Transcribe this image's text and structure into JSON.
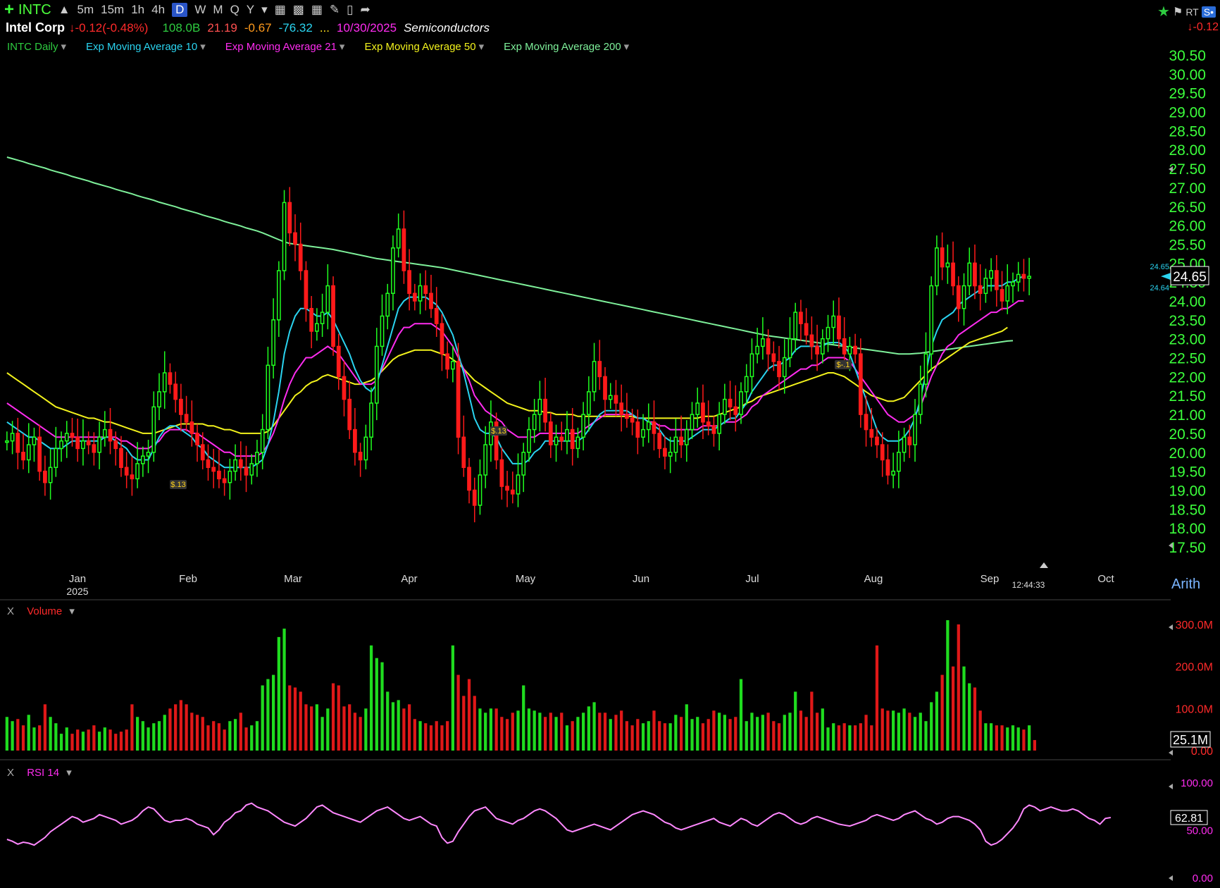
{
  "toolbar": {
    "ticker": "INTC",
    "timeframes": [
      "5m",
      "15m",
      "1h",
      "4h",
      "D",
      "W",
      "M",
      "Q",
      "Y"
    ],
    "active_timeframe": "D",
    "right_badge_rt": "RT",
    "right_badge_s": "S•",
    "right_change": "-0.12"
  },
  "info": {
    "name": "Intel Corp",
    "change": "-0.12(-0.48%)",
    "market_cap": "108.0B",
    "pe": "21.19",
    "v1": "-0.67",
    "v2": "-76.32",
    "dots": "...",
    "date": "10/30/2025",
    "sector": "Semiconductors"
  },
  "studies": [
    {
      "label": "INTC Daily",
      "color": "#2ecc40"
    },
    {
      "label": "Exp Moving Average 10",
      "color": "#2ad4f0"
    },
    {
      "label": "Exp Moving Average 21",
      "color": "#ff2cf0"
    },
    {
      "label": "Exp Moving Average 50",
      "color": "#f2f21c"
    },
    {
      "label": "Exp Moving Average 200",
      "color": "#7ef09a"
    }
  ],
  "chart_data": {
    "type": "candlestick",
    "price_axis": {
      "ticks": [
        "30.50",
        "30.00",
        "29.50",
        "29.00",
        "28.50",
        "28.00",
        "27.50",
        "27.00",
        "26.50",
        "26.00",
        "25.50",
        "25.00",
        "24.50",
        "24.00",
        "23.50",
        "23.00",
        "22.50",
        "22.00",
        "21.50",
        "21.00",
        "20.50",
        "20.00",
        "19.50",
        "19.00",
        "18.50",
        "18.00",
        "17.50"
      ],
      "range": [
        17.5,
        30.5
      ],
      "last_price": "24.65",
      "marker_high": "24.65",
      "marker_low": "24.64"
    },
    "x_axis": {
      "labels": [
        "Jan",
        "Feb",
        "Mar",
        "Apr",
        "May",
        "Jun",
        "Jul",
        "Aug",
        "Sep",
        "Oct"
      ],
      "year_label": "2025",
      "time_label": "12:44:33",
      "scale_label": "Arith"
    },
    "dividend_markers": [
      "$.13",
      "$.13",
      "$-.1"
    ],
    "close": [
      20.3,
      20.5,
      20.0,
      19.8,
      20.2,
      20.4,
      19.5,
      19.2,
      19.6,
      20.1,
      20.3,
      20.5,
      20.4,
      20.1,
      20.3,
      20.2,
      20.0,
      20.4,
      20.6,
      20.3,
      20.1,
      19.6,
      19.4,
      19.3,
      19.7,
      19.9,
      20.0,
      21.2,
      21.6,
      22.1,
      21.8,
      21.4,
      21.0,
      20.8,
      20.5,
      20.2,
      19.8,
      19.6,
      19.5,
      19.3,
      19.2,
      19.5,
      19.8,
      19.6,
      19.4,
      19.7,
      20.0,
      20.6,
      22.3,
      23.5,
      24.8,
      26.6,
      25.8,
      25.5,
      24.8,
      23.8,
      23.2,
      23.4,
      23.7,
      24.4,
      22.8,
      22.0,
      21.4,
      20.6,
      20.0,
      19.8,
      20.4,
      21.3,
      22.8,
      23.6,
      24.2,
      25.4,
      25.9,
      24.8,
      24.2,
      24.0,
      24.4,
      24.2,
      23.8,
      23.4,
      22.6,
      22.2,
      22.4,
      20.4,
      19.6,
      19.0,
      18.6,
      19.4,
      20.2,
      20.8,
      19.8,
      19.1,
      19.0,
      18.9,
      19.4,
      20.0,
      20.6,
      21.0,
      21.4,
      20.8,
      20.2,
      20.4,
      20.3,
      20.6,
      20.1,
      20.4,
      21.0,
      21.6,
      22.4,
      22.0,
      21.4,
      21.5,
      21.3,
      21.0,
      20.9,
      20.8,
      20.4,
      20.6,
      20.8,
      20.5,
      20.1,
      19.9,
      20.0,
      20.4,
      20.2,
      20.6,
      21.0,
      21.3,
      20.8,
      20.7,
      20.5,
      21.0,
      21.4,
      21.2,
      21.0,
      21.6,
      22.0,
      22.6,
      22.8,
      23.0,
      22.6,
      22.4,
      22.0,
      22.5,
      23.0,
      23.7,
      23.4,
      23.1,
      22.8,
      22.6,
      23.0,
      23.3,
      23.6,
      23.0,
      22.6,
      22.8,
      22.6,
      21.0,
      20.6,
      20.4,
      20.2,
      19.8,
      19.4,
      19.5,
      20.0,
      20.4,
      20.2,
      21.0,
      21.8,
      22.6,
      24.4,
      25.4,
      24.9,
      25.0,
      24.4,
      23.8,
      24.4,
      25.0,
      24.4,
      24.2,
      24.6,
      24.8,
      24.3,
      24.0,
      24.4,
      24.5,
      24.7,
      24.6,
      24.65
    ],
    "ema10": [
      20.8,
      20.7,
      20.6,
      20.5,
      20.4,
      20.4,
      20.3,
      20.2,
      20.1,
      20.1,
      20.1,
      20.2,
      20.3,
      20.3,
      20.3,
      20.3,
      20.3,
      20.3,
      20.4,
      20.4,
      20.3,
      20.2,
      20.1,
      19.9,
      19.8,
      19.8,
      19.8,
      20.1,
      20.4,
      20.6,
      20.7,
      20.7,
      20.6,
      20.5,
      20.4,
      20.2,
      20.1,
      19.9,
      19.8,
      19.7,
      19.6,
      19.6,
      19.6,
      19.6,
      19.6,
      19.6,
      19.7,
      19.8,
      20.2,
      20.8,
      21.6,
      22.6,
      23.2,
      23.6,
      23.8,
      23.8,
      23.7,
      23.6,
      23.6,
      23.7,
      23.5,
      23.2,
      22.9,
      22.6,
      22.2,
      21.9,
      21.7,
      21.6,
      21.8,
      22.3,
      22.8,
      23.3,
      23.8,
      24.0,
      24.1,
      24.1,
      24.1,
      24.1,
      24.0,
      23.9,
      23.7,
      23.4,
      23.1,
      22.6,
      22.1,
      21.5,
      20.9,
      20.6,
      20.5,
      20.5,
      20.4,
      20.1,
      19.9,
      19.7,
      19.7,
      19.7,
      19.8,
      20.0,
      20.1,
      20.3,
      20.3,
      20.3,
      20.3,
      20.3,
      20.3,
      20.3,
      20.4,
      20.6,
      20.8,
      21.0,
      21.1,
      21.1,
      21.1,
      21.1,
      21.1,
      21.0,
      20.9,
      20.9,
      20.8,
      20.7,
      20.6,
      20.4,
      20.3,
      20.3,
      20.3,
      20.3,
      20.4,
      20.5,
      20.6,
      20.6,
      20.6,
      20.7,
      20.8,
      20.9,
      20.9,
      21.1,
      21.3,
      21.6,
      21.8,
      22.0,
      22.2,
      22.3,
      22.3,
      22.4,
      22.5,
      22.7,
      22.8,
      22.8,
      22.8,
      22.8,
      22.8,
      22.9,
      22.9,
      22.9,
      22.8,
      22.6,
      22.2,
      21.8,
      21.4,
      21.0,
      20.6,
      20.4,
      20.3,
      20.3,
      20.3,
      20.4,
      20.6,
      20.9,
      21.4,
      22.1,
      22.8,
      23.2,
      23.5,
      23.6,
      23.7,
      23.9,
      24.0,
      24.1,
      24.2,
      24.3,
      24.4,
      24.4,
      24.4,
      24.4,
      24.5,
      24.5,
      24.6,
      24.65
    ],
    "ema21": [
      21.3,
      21.2,
      21.1,
      21.0,
      20.9,
      20.8,
      20.7,
      20.6,
      20.5,
      20.4,
      20.4,
      20.4,
      20.4,
      20.4,
      20.4,
      20.4,
      20.4,
      20.4,
      20.4,
      20.4,
      20.4,
      20.3,
      20.3,
      20.2,
      20.1,
      20.1,
      20.1,
      20.2,
      20.3,
      20.5,
      20.6,
      20.6,
      20.6,
      20.6,
      20.5,
      20.5,
      20.4,
      20.3,
      20.2,
      20.1,
      20.0,
      20.0,
      19.9,
      19.9,
      19.9,
      19.9,
      19.9,
      20.0,
      20.2,
      20.5,
      20.9,
      21.4,
      21.8,
      22.1,
      22.3,
      22.5,
      22.5,
      22.6,
      22.7,
      22.8,
      22.7,
      22.6,
      22.4,
      22.2,
      22.0,
      21.8,
      21.8,
      21.8,
      21.9,
      22.2,
      22.5,
      22.8,
      23.1,
      23.3,
      23.3,
      23.4,
      23.4,
      23.4,
      23.4,
      23.3,
      23.2,
      23.0,
      22.8,
      22.5,
      22.2,
      21.9,
      21.5,
      21.3,
      21.1,
      21.0,
      20.9,
      20.8,
      20.6,
      20.5,
      20.4,
      20.4,
      20.4,
      20.4,
      20.5,
      20.5,
      20.5,
      20.5,
      20.5,
      20.5,
      20.5,
      20.5,
      20.6,
      20.7,
      20.8,
      20.9,
      21.0,
      21.0,
      21.0,
      21.0,
      21.0,
      21.0,
      20.9,
      20.9,
      20.8,
      20.8,
      20.7,
      20.7,
      20.6,
      20.6,
      20.6,
      20.6,
      20.6,
      20.6,
      20.7,
      20.7,
      20.7,
      20.7,
      20.8,
      20.8,
      20.8,
      20.9,
      21.0,
      21.2,
      21.3,
      21.5,
      21.6,
      21.7,
      21.8,
      21.9,
      22.0,
      22.1,
      22.2,
      22.2,
      22.3,
      22.3,
      22.4,
      22.5,
      22.5,
      22.5,
      22.5,
      22.4,
      22.2,
      22.0,
      21.8,
      21.6,
      21.4,
      21.2,
      21.0,
      20.9,
      20.8,
      20.8,
      20.9,
      21.0,
      21.2,
      21.6,
      22.0,
      22.3,
      22.6,
      22.8,
      22.9,
      23.1,
      23.2,
      23.3,
      23.4,
      23.5,
      23.6,
      23.7,
      23.7,
      23.8,
      23.8,
      23.9,
      24.0,
      24.0
    ],
    "ema50": [
      22.1,
      22.0,
      21.9,
      21.8,
      21.7,
      21.6,
      21.5,
      21.4,
      21.3,
      21.2,
      21.15,
      21.1,
      21.05,
      21.0,
      20.95,
      20.9,
      20.9,
      20.85,
      20.8,
      20.8,
      20.75,
      20.7,
      20.65,
      20.6,
      20.55,
      20.5,
      20.5,
      20.5,
      20.55,
      20.6,
      20.65,
      20.7,
      20.75,
      20.75,
      20.75,
      20.75,
      20.75,
      20.7,
      20.7,
      20.65,
      20.6,
      20.6,
      20.55,
      20.5,
      20.5,
      20.5,
      20.5,
      20.5,
      20.55,
      20.7,
      20.9,
      21.1,
      21.3,
      21.5,
      21.6,
      21.75,
      21.85,
      21.9,
      22.0,
      22.05,
      22.0,
      21.95,
      21.9,
      21.85,
      21.8,
      21.8,
      21.85,
      21.9,
      22.0,
      22.15,
      22.3,
      22.45,
      22.55,
      22.6,
      22.65,
      22.7,
      22.7,
      22.7,
      22.7,
      22.65,
      22.6,
      22.55,
      22.45,
      22.35,
      22.2,
      22.05,
      21.9,
      21.8,
      21.7,
      21.6,
      21.5,
      21.4,
      21.3,
      21.25,
      21.2,
      21.15,
      21.1,
      21.1,
      21.1,
      21.05,
      21.05,
      21.0,
      21.0,
      21.0,
      21.0,
      20.95,
      20.95,
      20.95,
      20.95,
      20.95,
      20.95,
      20.95,
      20.95,
      20.95,
      20.95,
      20.95,
      20.9,
      20.9,
      20.9,
      20.9,
      20.9,
      20.9,
      20.9,
      20.9,
      20.9,
      20.9,
      20.9,
      20.9,
      20.95,
      20.95,
      20.95,
      21.0,
      21.05,
      21.1,
      21.15,
      21.2,
      21.3,
      21.35,
      21.45,
      21.5,
      21.55,
      21.6,
      21.65,
      21.7,
      21.75,
      21.8,
      21.85,
      21.9,
      21.95,
      22.0,
      22.05,
      22.1,
      22.1,
      22.05,
      22.0,
      21.9,
      21.8,
      21.7,
      21.6,
      21.5,
      21.45,
      21.4,
      21.35,
      21.35,
      21.4,
      21.45,
      21.6,
      21.75,
      21.9,
      22.05,
      22.2,
      22.3,
      22.4,
      22.5,
      22.6,
      22.7,
      22.8,
      22.9,
      22.95,
      23.0,
      23.05,
      23.1,
      23.15,
      23.2,
      23.3
    ],
    "ema200": [
      27.8,
      27.76,
      27.72,
      27.68,
      27.63,
      27.59,
      27.55,
      27.51,
      27.46,
      27.42,
      27.38,
      27.34,
      27.29,
      27.25,
      27.21,
      27.17,
      27.12,
      27.08,
      27.04,
      27.0,
      26.95,
      26.91,
      26.87,
      26.83,
      26.78,
      26.74,
      26.7,
      26.66,
      26.61,
      26.57,
      26.53,
      26.49,
      26.44,
      26.4,
      26.36,
      26.32,
      26.27,
      26.23,
      26.19,
      26.15,
      26.1,
      26.06,
      26.02,
      25.98,
      25.93,
      25.89,
      25.85,
      25.8,
      25.74,
      25.68,
      25.62,
      25.56,
      25.52,
      25.5,
      25.48,
      25.46,
      25.44,
      25.42,
      25.4,
      25.38,
      25.36,
      25.33,
      25.3,
      25.27,
      25.24,
      25.21,
      25.18,
      25.15,
      25.12,
      25.1,
      25.08,
      25.06,
      25.04,
      25.02,
      25.0,
      24.98,
      24.96,
      24.94,
      24.92,
      24.9,
      24.88,
      24.85,
      24.82,
      24.79,
      24.76,
      24.73,
      24.7,
      24.67,
      24.64,
      24.61,
      24.58,
      24.55,
      24.52,
      24.49,
      24.46,
      24.43,
      24.4,
      24.37,
      24.34,
      24.31,
      24.28,
      24.25,
      24.22,
      24.19,
      24.16,
      24.13,
      24.1,
      24.07,
      24.04,
      24.01,
      23.98,
      23.95,
      23.92,
      23.89,
      23.86,
      23.83,
      23.8,
      23.77,
      23.74,
      23.71,
      23.68,
      23.65,
      23.62,
      23.59,
      23.56,
      23.53,
      23.5,
      23.47,
      23.44,
      23.41,
      23.38,
      23.35,
      23.32,
      23.29,
      23.26,
      23.23,
      23.2,
      23.17,
      23.14,
      23.11,
      23.08,
      23.06,
      23.04,
      23.02,
      23.0,
      22.98,
      22.96,
      22.94,
      22.92,
      22.9,
      22.88,
      22.86,
      22.84,
      22.82,
      22.8,
      22.78,
      22.76,
      22.74,
      22.72,
      22.7,
      22.68,
      22.66,
      22.64,
      22.62,
      22.6,
      22.6,
      22.6,
      22.61,
      22.62,
      22.64,
      22.66,
      22.68,
      22.7,
      22.72,
      22.74,
      22.76,
      22.78,
      22.8,
      22.82,
      22.84,
      22.86,
      22.88,
      22.9,
      22.92,
      22.94,
      22.95
    ],
    "volume_axis": {
      "label": "Volume",
      "ticks": [
        "300.0M",
        "200.0M",
        "100.0M",
        "0.00"
      ],
      "range": [
        0,
        310
      ],
      "last": "25.1M"
    },
    "volume_m": [
      80,
      70,
      75,
      60,
      85,
      55,
      60,
      110,
      80,
      65,
      40,
      55,
      40,
      50,
      45,
      50,
      60,
      45,
      55,
      50,
      40,
      45,
      50,
      110,
      80,
      70,
      55,
      65,
      70,
      85,
      100,
      110,
      120,
      110,
      90,
      85,
      80,
      60,
      70,
      65,
      50,
      70,
      75,
      90,
      55,
      60,
      70,
      155,
      170,
      180,
      270,
      290,
      155,
      150,
      140,
      110,
      105,
      110,
      80,
      100,
      160,
      155,
      105,
      110,
      90,
      80,
      100,
      250,
      220,
      210,
      140,
      115,
      120,
      100,
      110,
      75,
      70,
      65,
      60,
      70,
      60,
      70,
      250,
      180,
      130,
      170,
      130,
      100,
      90,
      100,
      100,
      80,
      75,
      90,
      95,
      155,
      100,
      95,
      90,
      80,
      90,
      80,
      90,
      60,
      70,
      80,
      90,
      105,
      115,
      90,
      90,
      75,
      85,
      95,
      70,
      60,
      75,
      65,
      70,
      95,
      70,
      65,
      65,
      85,
      80,
      110,
      75,
      80,
      65,
      75,
      95,
      90,
      85,
      75,
      80,
      170,
      70,
      90,
      80,
      85,
      90,
      70,
      65,
      85,
      90,
      140,
      95,
      80,
      140,
      90,
      100,
      55,
      65,
      60,
      65,
      60,
      60,
      65,
      85,
      60,
      250,
      100,
      95,
      95,
      90,
      100,
      90,
      80,
      90,
      70,
      115,
      140,
      180,
      310,
      200,
      300,
      200,
      160,
      150,
      95,
      65,
      65,
      60,
      60,
      55,
      60,
      55,
      50,
      60,
      25
    ],
    "rsi": {
      "label": "RSI 14",
      "ticks": [
        "100.00",
        "50.00",
        "0.00"
      ],
      "last": "62.81",
      "values": [
        40,
        38,
        35,
        37,
        36,
        34,
        38,
        42,
        48,
        52,
        56,
        60,
        64,
        62,
        58,
        60,
        62,
        66,
        64,
        62,
        60,
        56,
        58,
        60,
        64,
        70,
        74,
        72,
        66,
        60,
        58,
        60,
        60,
        62,
        60,
        56,
        54,
        52,
        45,
        50,
        58,
        62,
        68,
        70,
        76,
        78,
        74,
        72,
        70,
        66,
        62,
        58,
        56,
        54,
        58,
        62,
        68,
        74,
        76,
        72,
        68,
        66,
        64,
        62,
        60,
        58,
        62,
        66,
        70,
        72,
        74,
        70,
        66,
        62,
        60,
        62,
        64,
        60,
        56,
        54,
        42,
        36,
        38,
        48,
        56,
        64,
        70,
        72,
        74,
        68,
        62,
        60,
        58,
        56,
        60,
        62,
        66,
        70,
        72,
        70,
        66,
        62,
        56,
        50,
        48,
        50,
        52,
        54,
        56,
        54,
        52,
        50,
        54,
        58,
        62,
        66,
        68,
        70,
        68,
        66,
        62,
        58,
        56,
        52,
        50,
        52,
        54,
        56,
        58,
        60,
        62,
        58,
        56,
        54,
        58,
        62,
        60,
        56,
        54,
        58,
        62,
        66,
        68,
        66,
        62,
        58,
        56,
        58,
        62,
        64,
        62,
        60,
        58,
        56,
        55,
        54,
        56,
        58,
        60,
        64,
        66,
        64,
        62,
        60,
        62,
        66,
        68,
        70,
        66,
        62,
        60,
        56,
        58,
        62,
        64,
        64,
        62,
        60,
        56,
        50,
        38,
        34,
        36,
        40,
        46,
        52,
        60,
        72,
        76,
        74,
        70,
        72,
        74,
        72,
        70,
        70,
        72,
        70,
        66,
        62,
        60,
        56,
        62,
        63
      ]
    }
  },
  "tooltips": {
    "grid": "off"
  }
}
